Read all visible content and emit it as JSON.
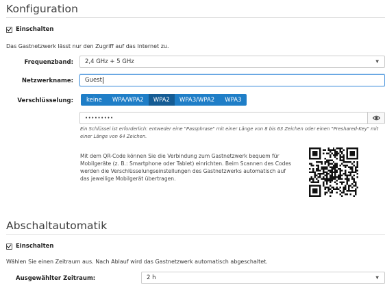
{
  "konfiguration": {
    "title": "Konfiguration",
    "enable_label": "Einschalten",
    "description": "Das Gastnetzwerk lässt nur den Zugriff auf das Internet zu.",
    "frequency_label": "Frequenzband:",
    "frequency_value": "2,4 GHz + 5 GHz",
    "network_name_label": "Netzwerkname:",
    "network_name_value": "Guest",
    "encryption_label": "Verschlüsselung:",
    "encryption_options": [
      "keine",
      "WPA/WPA2",
      "WPA2",
      "WPA3/WPA2",
      "WPA3"
    ],
    "encryption_selected": "WPA2",
    "key_value": "•••••••••",
    "key_hint": "Ein Schlüssel ist erforderlich: entweder eine \"Passphrase\" mit einer Länge von 8 bis 63 Zeichen oder einen \"Preshared-Key\" mit einer Länge von 64 Zeichen.",
    "qr_text": "Mit dem QR-Code können Sie die Verbindung zum Gastnetzwerk bequem für Mobilgeräte (z. B.: Smartphone oder Tablet) einrichten. Beim Scannen des Codes werden die Verschlüsselungseinstellungen des Gastnetzwerks automatisch auf das jeweilige Mobilgerät übertragen."
  },
  "abschaltautomatik": {
    "title": "Abschaltautomatik",
    "enable_label": "Einschalten",
    "description": "Wählen Sie einen Zeitraum aus. Nach Ablauf wird das Gastnetzwerk automatisch abgeschaltet.",
    "period_label": "Ausgewählter Zeitraum:",
    "period_value": "2 h"
  },
  "icons": {
    "dropdown": "chevron-down-icon",
    "eye": "eye-icon",
    "checkbox": "checkbox-checked-icon",
    "qr": "qr-code-image"
  },
  "colors": {
    "accent": "#1f7ec7",
    "accent_active": "#155c94",
    "focus": "#5a9ee0"
  }
}
